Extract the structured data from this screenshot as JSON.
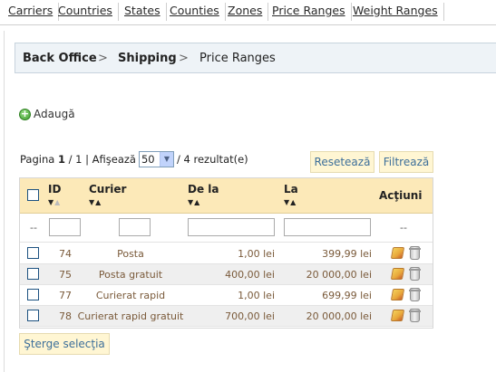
{
  "top_nav": {
    "tabs": [
      "Carriers",
      "Countries",
      "States",
      "Counties",
      "Zones",
      "Price Ranges",
      "Weight Ranges"
    ]
  },
  "breadcrumb": {
    "items": [
      "Back Office",
      "Shipping",
      "Price Ranges"
    ],
    "separator": ">"
  },
  "add_label": "Adaugă",
  "pager": {
    "page_label": "Pagina",
    "page_current": "1",
    "page_total": "/ 1",
    "show_label": "| Afişează",
    "per_page": "50",
    "results": "/ 4 rezultat(e)"
  },
  "buttons": {
    "reset": "Resetează",
    "filter": "Filtrează",
    "delete_selection": "Şterge selecţia"
  },
  "table": {
    "headers": {
      "id": "ID",
      "carrier": "Curier",
      "from": "De la",
      "to": "La",
      "actions": "Acţiuni"
    },
    "filter_placeholder": "--",
    "rows": [
      {
        "id": "74",
        "carrier": "Posta",
        "from": "1,00 lei",
        "to": "399,99 lei"
      },
      {
        "id": "75",
        "carrier": "Posta gratuit",
        "from": "400,00 lei",
        "to": "20 000,00 lei"
      },
      {
        "id": "77",
        "carrier": "Curierat rapid",
        "from": "1,00 lei",
        "to": "699,99 lei"
      },
      {
        "id": "78",
        "carrier": "Curierat rapid gratuit",
        "from": "700,00 lei",
        "to": "20 000,00 lei"
      }
    ]
  },
  "icons": {
    "add": "plus-circle-icon",
    "edit": "pencil-icon",
    "delete": "trash-icon",
    "sort": "sort-arrows-icon"
  },
  "colors": {
    "header_bg": "#fce9b8",
    "button_bg": "#fff6d3",
    "button_text": "#3d6f9a",
    "breadcrumb_bg": "#eef3f7",
    "row_alt_bg": "#efefef",
    "cell_text": "#7a5a3a"
  }
}
